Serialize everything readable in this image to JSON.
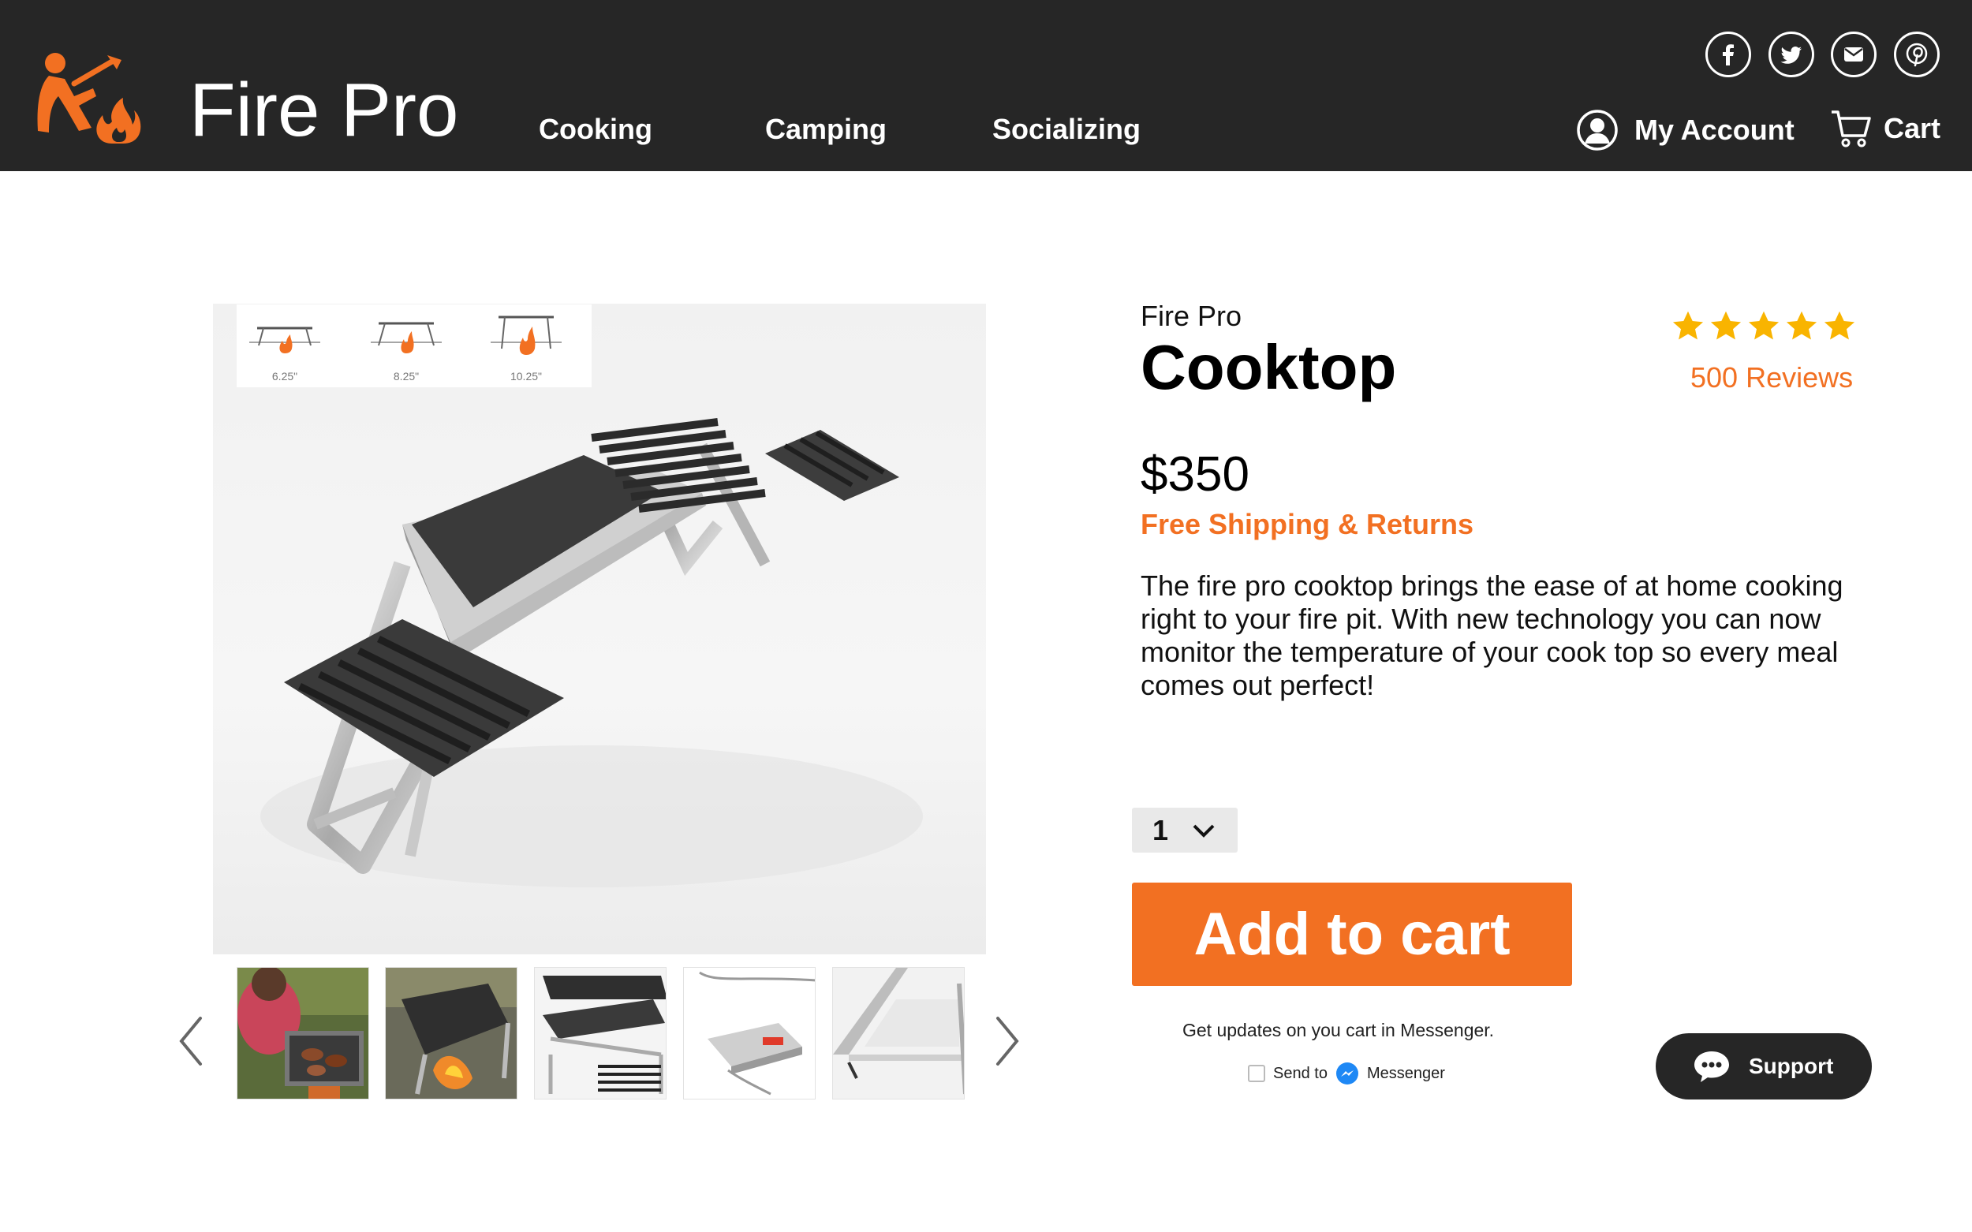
{
  "header": {
    "brand": "Fire Pro",
    "nav": [
      {
        "label": "Cooking"
      },
      {
        "label": "Camping"
      },
      {
        "label": "Socializing"
      }
    ],
    "account_label": "My Account",
    "cart_label": "Cart",
    "social_icons": [
      "facebook-icon",
      "twitter-icon",
      "email-icon",
      "pinterest-icon"
    ]
  },
  "gallery": {
    "heights": [
      "6.25\"",
      "8.25\"",
      "10.25\""
    ],
    "thumbnails": [
      "cooking-on-firepit",
      "cooktop-over-fire",
      "exploded-parts",
      "temperature-controller",
      "cooktop-corner"
    ]
  },
  "product": {
    "brand": "Fire Pro",
    "title": "Cooktop",
    "rating_stars": 5,
    "reviews": "500 Reviews",
    "price": "$350",
    "shipping": "Free Shipping & Returns",
    "description": "The fire pro cooktop brings the ease of at home cooking right to your fire pit. With new technology you can now monitor the temperature of your cook top so every meal comes  out perfect!",
    "quantity": "1",
    "add_to_cart": "Add to cart",
    "messenger_prompt": "Get updates on you cart in Messenger.",
    "send_to": "Send to",
    "messenger": "Messenger"
  },
  "support": {
    "label": "Support"
  },
  "colors": {
    "accent": "#f27022",
    "header": "#262626",
    "star": "#f9b400"
  }
}
